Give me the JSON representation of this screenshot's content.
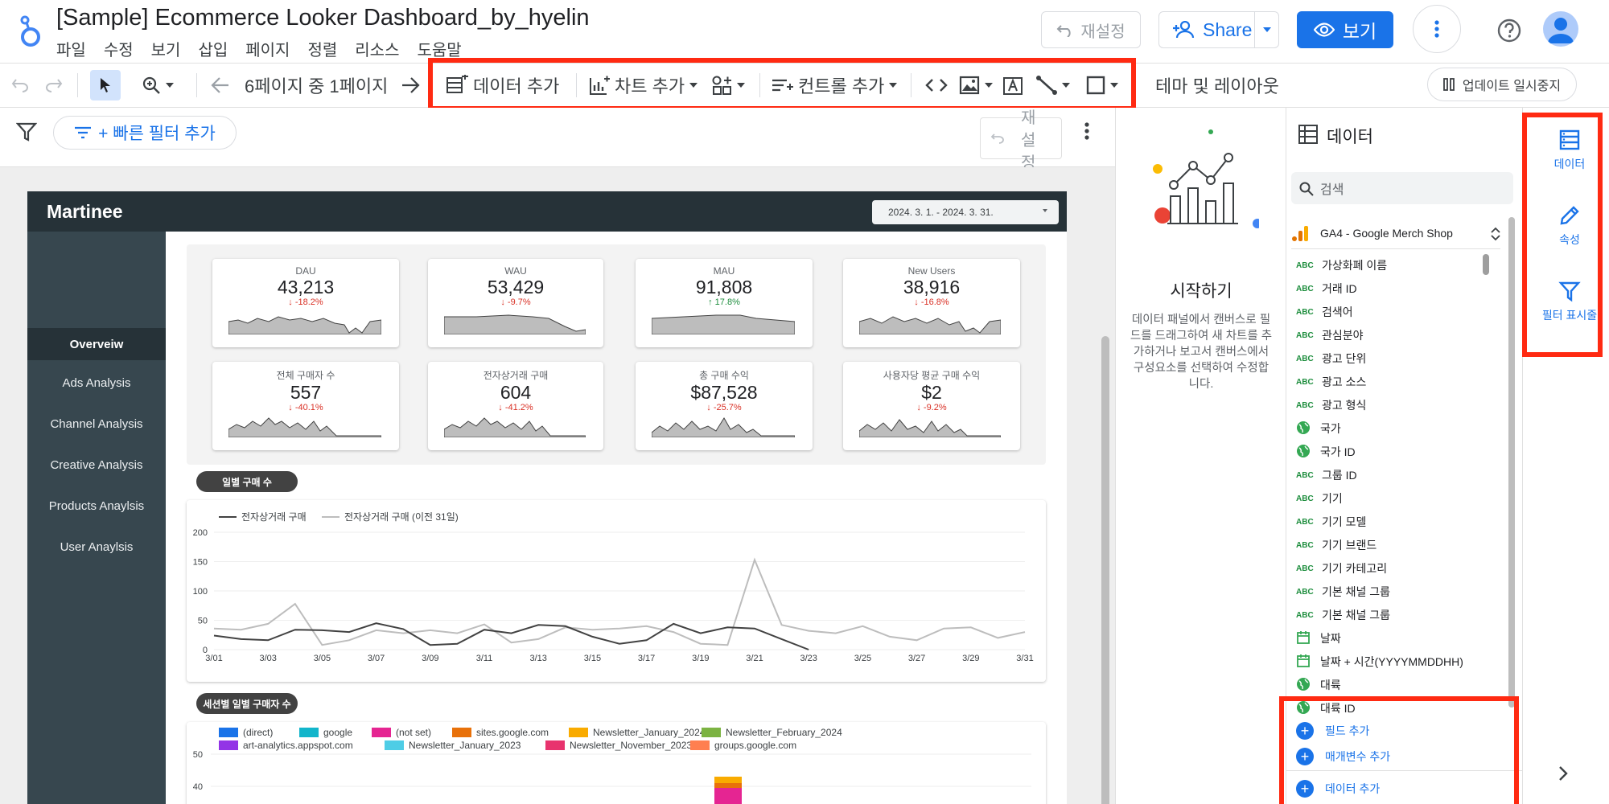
{
  "header": {
    "title": "[Sample] Ecommerce Looker Dashboard_by_hyelin",
    "menu": [
      "파일",
      "수정",
      "보기",
      "삽입",
      "페이지",
      "정렬",
      "리소스",
      "도움말"
    ],
    "reset_label": "재설정",
    "share_label": "Share",
    "view_label": "보기"
  },
  "toolbar": {
    "page_indicator": "6페이지 중 1페이지",
    "add_data": "데이터 추가",
    "add_chart": "차트 추가",
    "add_control": "컨트롤 추가",
    "theme_layout": "테마 및 레이아웃",
    "pause_updates": "업데이트 일시중지"
  },
  "filterbar": {
    "quick_filter": "+ 빠른 필터 추가",
    "reset_label": "재설정"
  },
  "report": {
    "brand": "Martinee",
    "date_range": "2024. 3. 1. - 2024. 3. 31.",
    "nav": [
      "Overveiw",
      "Ads Analysis",
      "Channel Analysis",
      "Creative Analysis",
      "Products Anaylsis",
      "User Anaylsis"
    ],
    "kpis": [
      {
        "label": "DAU",
        "value": "43,213",
        "change": "-18.2%",
        "trend": "down"
      },
      {
        "label": "WAU",
        "value": "53,429",
        "change": "-9.7%",
        "trend": "down"
      },
      {
        "label": "MAU",
        "value": "91,808",
        "change": "17.8%",
        "trend": "up"
      },
      {
        "label": "New Users",
        "value": "38,916",
        "change": "-16.8%",
        "trend": "down"
      },
      {
        "label": "전체 구매자 수",
        "value": "557",
        "change": "-40.1%",
        "trend": "down"
      },
      {
        "label": "전자상거래 구매",
        "value": "604",
        "change": "-41.2%",
        "trend": "down"
      },
      {
        "label": "총 구매 수익",
        "value": "$87,528",
        "change": "-25.7%",
        "trend": "down"
      },
      {
        "label": "사용자당 평균 구매 수익",
        "value": "$2",
        "change": "-9.2%",
        "trend": "down"
      }
    ],
    "daily_purchase_pill": "일별 구매 수",
    "session_pill": "세션별 일별 구매자 수",
    "session_legend": [
      {
        "name": "(direct)",
        "color": "#1a73e8"
      },
      {
        "name": "google",
        "color": "#12b5cb"
      },
      {
        "name": "(not set)",
        "color": "#e52592"
      },
      {
        "name": "sites.google.com",
        "color": "#e8710a"
      },
      {
        "name": "Newsletter_January_2024",
        "color": "#f9ab00"
      },
      {
        "name": "Newsletter_February_2024",
        "color": "#7cb342"
      },
      {
        "name": "art-analytics.appspot.com",
        "color": "#9334e6"
      },
      {
        "name": "Newsletter_January_2023",
        "color": "#4ecde6"
      },
      {
        "name": "Newsletter_November_2023",
        "color": "#e8336e"
      },
      {
        "name": "groups.google.com",
        "color": "#ff7f50"
      }
    ],
    "session_y_ticks": [
      "50",
      "40"
    ]
  },
  "chart_data": {
    "type": "line",
    "xlabel": "",
    "ylabel": "",
    "ylim": [
      0,
      200
    ],
    "y_ticks": [
      0,
      50,
      100,
      150,
      200
    ],
    "x": [
      "3/01",
      "3/02",
      "3/03",
      "3/04",
      "3/05",
      "3/06",
      "3/07",
      "3/08",
      "3/09",
      "3/10",
      "3/11",
      "3/12",
      "3/13",
      "3/14",
      "3/15",
      "3/16",
      "3/17",
      "3/18",
      "3/19",
      "3/20",
      "3/21",
      "3/22",
      "3/23",
      "3/24",
      "3/25",
      "3/26",
      "3/27",
      "3/28",
      "3/29",
      "3/30",
      "3/31"
    ],
    "x_tick_labels": [
      "3/01",
      "3/03",
      "3/05",
      "3/07",
      "3/09",
      "3/11",
      "3/13",
      "3/15",
      "3/17",
      "3/19",
      "3/21",
      "3/23",
      "3/25",
      "3/27",
      "3/29",
      "3/31"
    ],
    "series": [
      {
        "name": "전자상거래 구매",
        "color": "#424242",
        "values": [
          24,
          18,
          16,
          34,
          33,
          30,
          45,
          35,
          8,
          10,
          34,
          28,
          42,
          40,
          22,
          10,
          16,
          44,
          28,
          38,
          36,
          18,
          0,
          null,
          null,
          null,
          null,
          null,
          null,
          null,
          null
        ]
      },
      {
        "name": "전자상거래 구매 (이전 31일)",
        "color": "#bdbdbd",
        "values": [
          36,
          34,
          44,
          78,
          8,
          16,
          33,
          28,
          33,
          28,
          43,
          12,
          18,
          38,
          34,
          36,
          40,
          30,
          10,
          8,
          153,
          42,
          32,
          28,
          40,
          22,
          16,
          36,
          38,
          20,
          30
        ]
      }
    ]
  },
  "start_panel": {
    "title": "시작하기",
    "description": "데이터 패널에서 캔버스로 필드를 드래그하여 새 차트를 추가하거나 보고서 캔버스에서 구성요소를 선택하여 수정합니다."
  },
  "data_panel": {
    "title": "데이터",
    "search_placeholder": "검색",
    "source_name": "GA4 - Google Merch Shop",
    "fields": [
      {
        "type": "abc",
        "label": "가상화폐 이름"
      },
      {
        "type": "abc",
        "label": "거래 ID"
      },
      {
        "type": "abc",
        "label": "검색어"
      },
      {
        "type": "abc",
        "label": "관심분야"
      },
      {
        "type": "abc",
        "label": "광고 단위"
      },
      {
        "type": "abc",
        "label": "광고 소스"
      },
      {
        "type": "abc",
        "label": "광고 형식"
      },
      {
        "type": "geo",
        "label": "국가"
      },
      {
        "type": "geo",
        "label": "국가 ID"
      },
      {
        "type": "abc",
        "label": "그룹 ID"
      },
      {
        "type": "abc",
        "label": "기기"
      },
      {
        "type": "abc",
        "label": "기기 모델"
      },
      {
        "type": "abc",
        "label": "기기 브랜드"
      },
      {
        "type": "abc",
        "label": "기기 카테고리"
      },
      {
        "type": "abc",
        "label": "기본 채널 그룹"
      },
      {
        "type": "abc",
        "label": "기본 채널 그룹"
      },
      {
        "type": "date",
        "label": "날짜"
      },
      {
        "type": "date",
        "label": "날짜 + 시간(YYYYMMDDHH)"
      },
      {
        "type": "geo",
        "label": "대륙"
      },
      {
        "type": "geo",
        "label": "대륙 ID"
      }
    ],
    "abc_badge": "ABC",
    "add_field": "필드 추가",
    "add_param": "매개변수 추가",
    "add_data": "데이터 추가"
  },
  "rail": {
    "data": "데이터",
    "properties": "속성",
    "filter": "필터 표시줄"
  }
}
